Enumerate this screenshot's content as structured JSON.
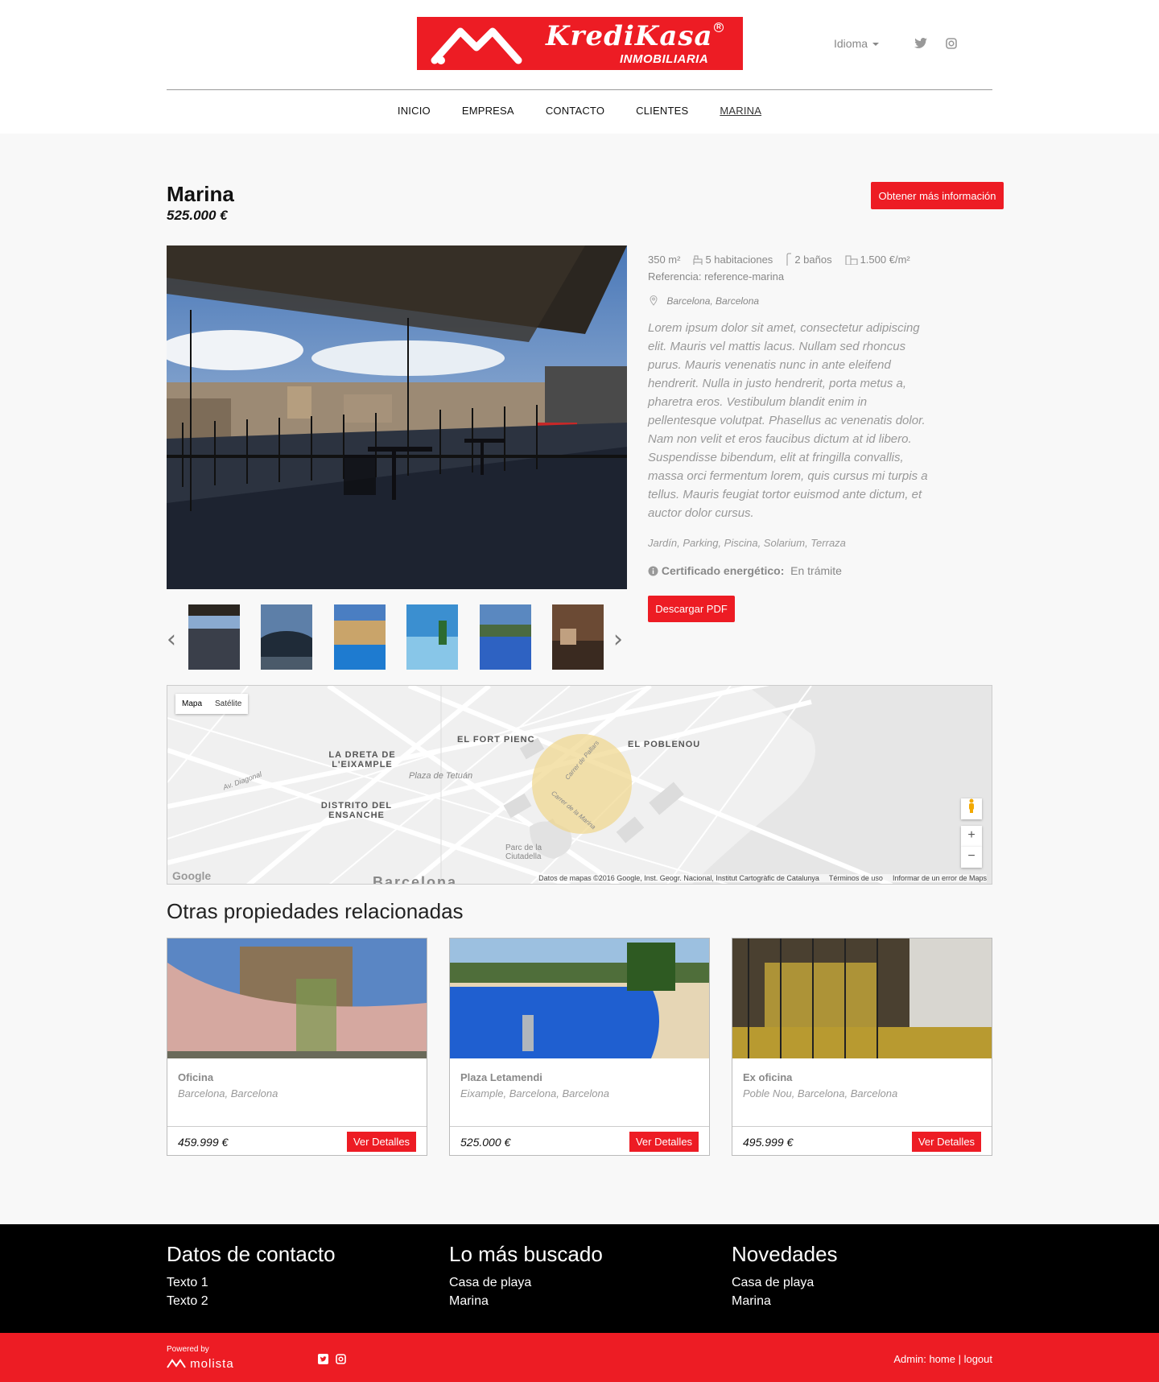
{
  "header": {
    "brand": "KrediKasa",
    "brand_sub": "INMOBILIARIA",
    "language_label": "Idioma"
  },
  "nav": [
    "INICIO",
    "EMPRESA",
    "CONTACTO",
    "CLIENTES",
    "MARINA"
  ],
  "property": {
    "title": "Marina",
    "price": "525.000 €",
    "info_button": "Obtener más información",
    "area": "350 m²",
    "rooms": "5 habitaciones",
    "baths": "2 baños",
    "price_m2": "1.500 €/m²",
    "reference": "Referencia: reference-marina",
    "location": "Barcelona, Barcelona",
    "description": "Lorem ipsum dolor sit amet, consectetur adipiscing elit. Mauris vel mattis lacus. Nullam sed rhoncus purus. Mauris venenatis nunc in ante eleifend hendrerit. Nulla in justo hendrerit, porta metus a, pharetra eros. Vestibulum blandit enim in pellentesque volutpat. Phasellus ac venenatis dolor. Nam non velit et eros faucibus dictum at id libero. Suspendisse bibendum, elit at fringilla convallis, massa orci fermentum lorem, quis cursus mi turpis a tellus. Mauris feugiat tortor euismod ante dictum, et auctor dolor cursus.",
    "features": "Jardín, Parking, Piscina, Solarium, Terraza",
    "energy_label": "Certificado energético:",
    "energy_value": "En trámite",
    "pdf_button": "Descargar PDF"
  },
  "map": {
    "tab_map": "Mapa",
    "tab_sat": "Satélite",
    "labels": [
      "EL FORT PIENC",
      "EL POBLENOU",
      "LA DRETA DE L'EIXAMPLE",
      "DISTRITO DEL ENSANCHE",
      "Plaza de Tetuán",
      "Parc de la Ciutadella",
      "Av. Diagonal",
      "Carrer de Pallars",
      "Carrer de la Marina"
    ],
    "credit": "Datos de mapas ©2016 Google, Inst. Geogr. Nacional, Institut Cartogràfic de Catalunya",
    "terms": "Términos de uso",
    "report": "Informar de un error de Maps",
    "google": "Google",
    "barcelona": "Barcelona"
  },
  "related": {
    "title": "Otras propiedades relacionadas",
    "button": "Ver Detalles",
    "items": [
      {
        "name": "Oficina",
        "location": "Barcelona, Barcelona",
        "price": "459.999 €"
      },
      {
        "name": "Plaza Letamendi",
        "location": "Eixample, Barcelona, Barcelona",
        "price": "525.000 €"
      },
      {
        "name": "Ex oficina",
        "location": "Poble Nou, Barcelona, Barcelona",
        "price": "495.999 €"
      }
    ]
  },
  "footer": {
    "col1_title": "Datos de contacto",
    "col1_items": [
      "Texto 1",
      "Texto 2"
    ],
    "col2_title": "Lo más buscado",
    "col2_items": [
      "Casa de playa",
      "Marina"
    ],
    "col3_title": "Novedades",
    "col3_items": [
      "Casa de playa",
      "Marina"
    ],
    "powered": "Powered by",
    "molista": "molista",
    "admin_prefix": "Admin:",
    "admin_home": "home",
    "admin_logout": "logout"
  },
  "colors": {
    "accent": "#ed1c24",
    "footer": "#000000",
    "page_bg": "#f8f8f8"
  }
}
